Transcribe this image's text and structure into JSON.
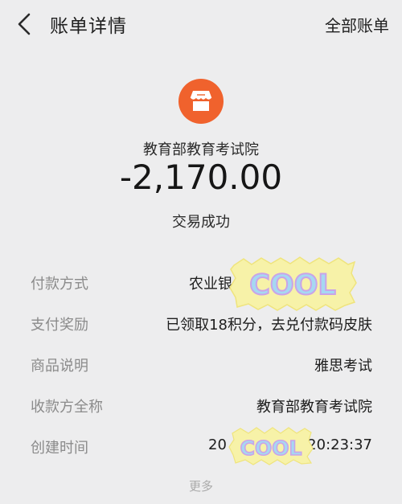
{
  "header": {
    "title": "账单详情",
    "all_bills_label": "全部账单"
  },
  "summary": {
    "merchant_icon": "shop-icon",
    "merchant_name": "教育部教育考试院",
    "amount": "-2,170.00",
    "status": "交易成功"
  },
  "details": [
    {
      "label": "付款方式",
      "value": "农业银"
    },
    {
      "label": "支付奖励",
      "value": "已领取18积分，去兑付款码皮肤"
    },
    {
      "label": "商品说明",
      "value": "雅思考试"
    },
    {
      "label": "收款方全称",
      "value": "教育部教育考试院"
    },
    {
      "label": "创建时间",
      "value_left": "20",
      "value_right": ":20:23:37"
    }
  ],
  "stickers": [
    {
      "text": "COOL"
    },
    {
      "text": "COOL"
    }
  ],
  "footer": {
    "more_label": "更多"
  },
  "colors": {
    "background": "#ededee",
    "merchant_icon_bg": "#f0622d",
    "label_gray": "#8b8b8b"
  }
}
